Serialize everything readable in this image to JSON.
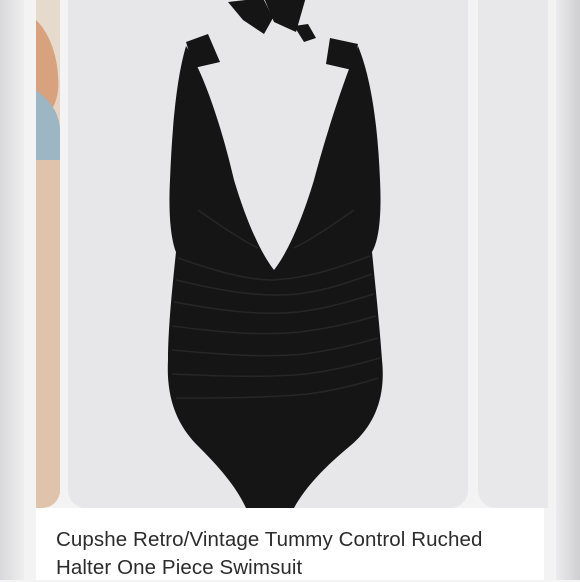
{
  "product": {
    "title": "Cupshe Retro/Vintage Tummy Control Ruched Halter One Piece Swimsuit",
    "image_subject": "black halter one-piece swimsuit"
  },
  "colors": {
    "screen_bg": "#f3f3f4",
    "card_bg": "#e7e7e9",
    "swimsuit": "#151515",
    "text": "#2b2b2b"
  }
}
